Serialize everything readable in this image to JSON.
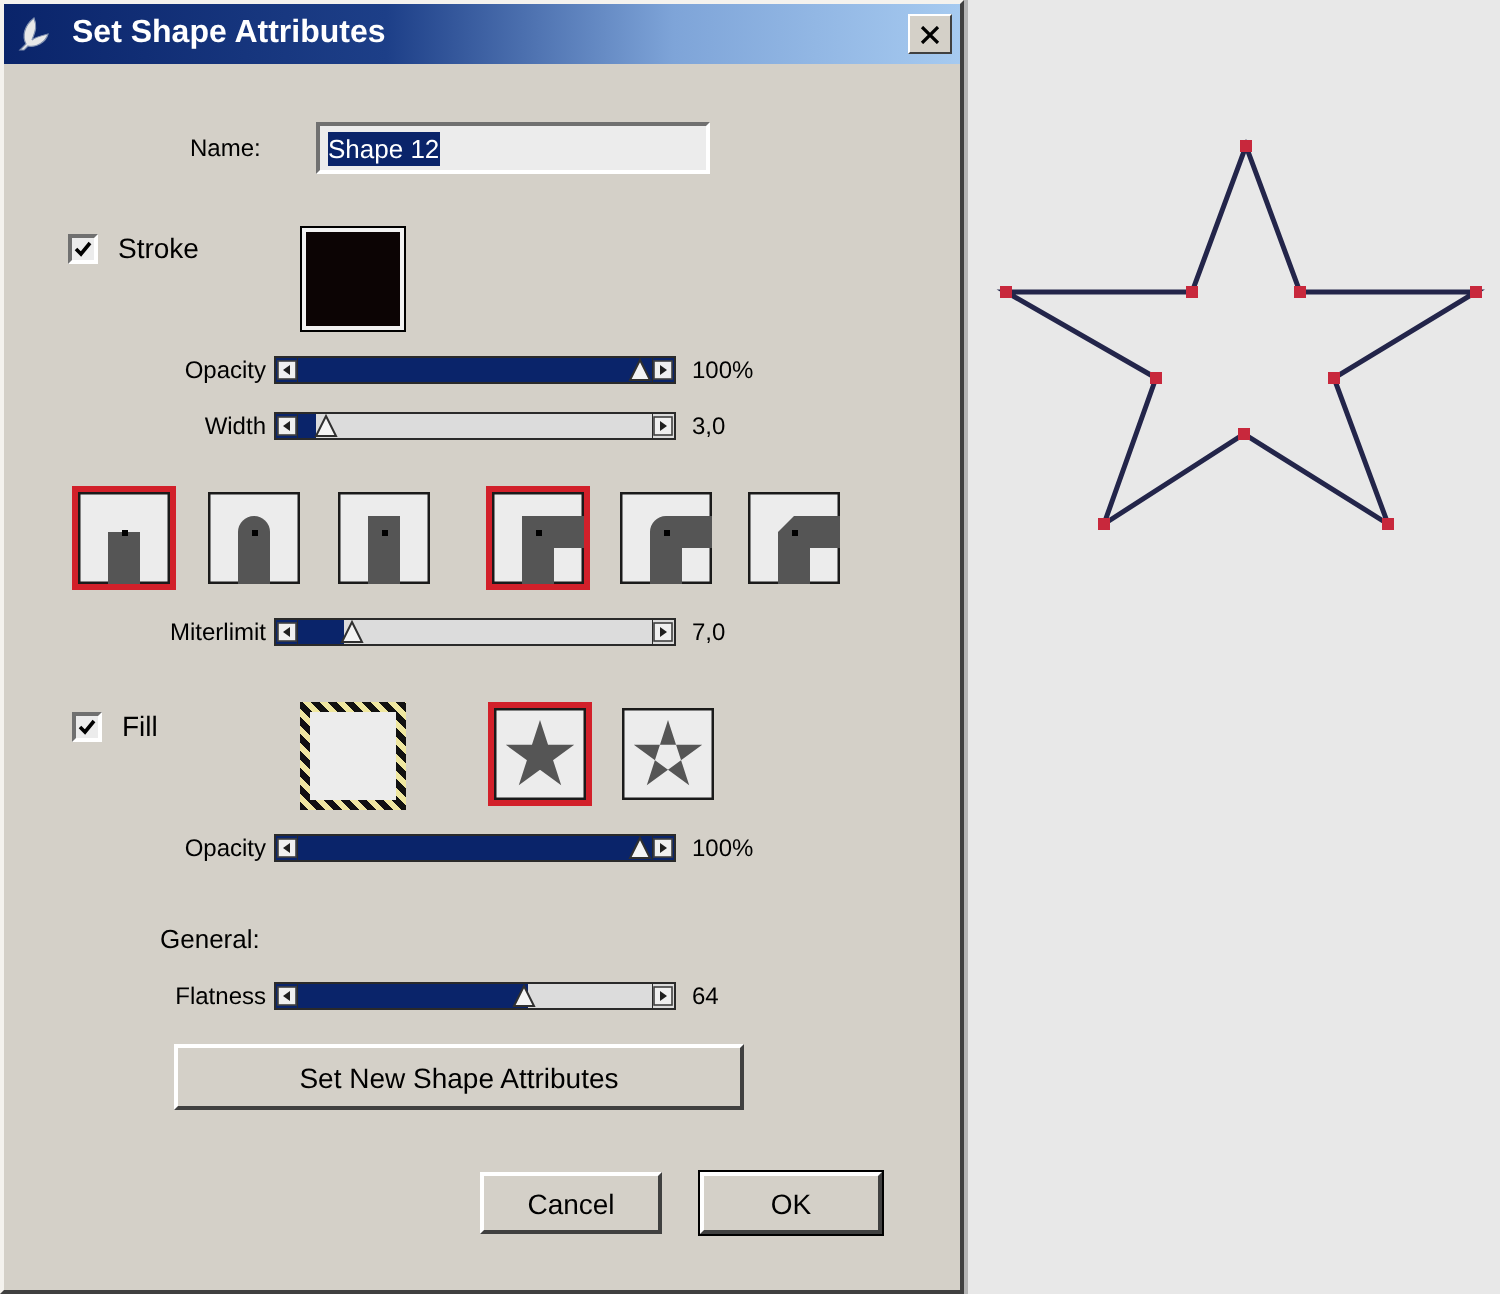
{
  "window": {
    "title": "Set Shape Attributes"
  },
  "name_field": {
    "label": "Name:",
    "value": "Shape 12",
    "highlighted": true
  },
  "stroke": {
    "label": "Stroke",
    "checked": true,
    "color": "#0c0404",
    "opacity": {
      "label": "Opacity",
      "level": 1,
      "reading": "100%"
    },
    "width": {
      "label": "Width",
      "level": 0.05,
      "reading": "3,0"
    }
  },
  "caps": [
    {
      "kind": "butt",
      "selected": true
    },
    {
      "kind": "round",
      "selected": false
    },
    {
      "kind": "square",
      "selected": false
    }
  ],
  "joins": [
    {
      "kind": "miter",
      "selected": true
    },
    {
      "kind": "round",
      "selected": false
    },
    {
      "kind": "bevel",
      "selected": false
    }
  ],
  "miterlimit": {
    "label": "Miterlimit",
    "level": 0.13,
    "reading": "7,0"
  },
  "fill": {
    "label": "Fill",
    "checked": true,
    "color": "#ececec",
    "rules": [
      {
        "kind": "nonzero",
        "selected": true
      },
      {
        "kind": "evenodd",
        "selected": false
      }
    ],
    "opacity": {
      "label": "Opacity",
      "level": 1,
      "reading": "100%"
    }
  },
  "general": {
    "heading": "General:",
    "flatness": {
      "label": "Flatness",
      "level": 0.65,
      "reading": "64"
    }
  },
  "apply_button": {
    "label": "Set New Shape Attributes"
  },
  "buttons": [
    {
      "label": "Cancel",
      "default": false
    },
    {
      "label": "OK",
      "default": true
    }
  ]
}
